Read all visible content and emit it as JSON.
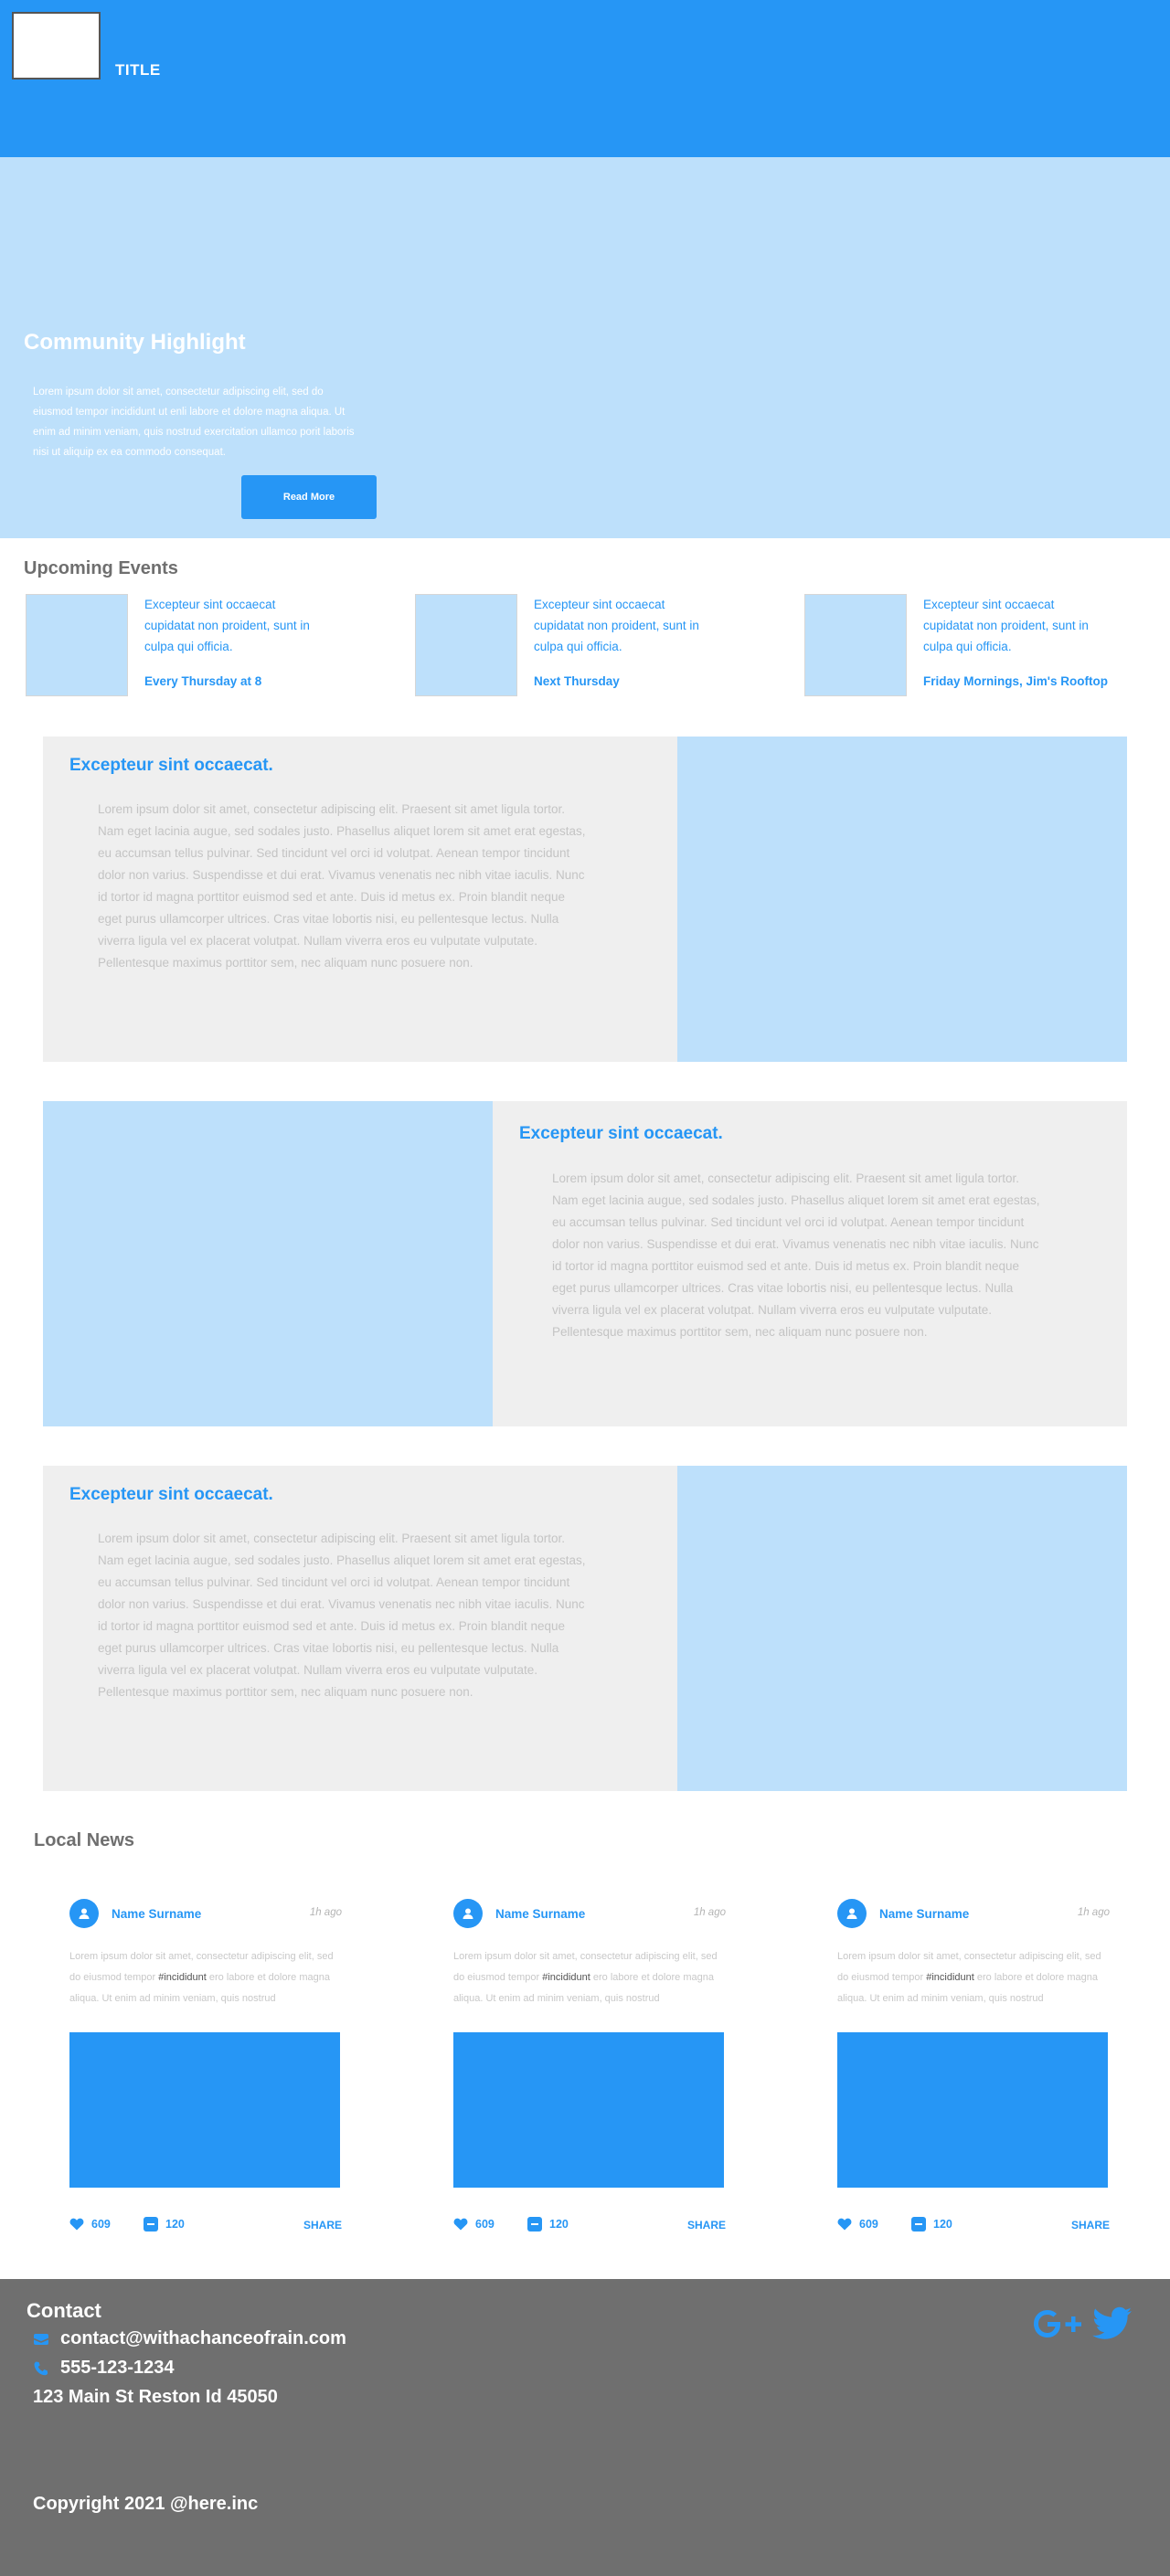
{
  "header": {
    "title": "TITLE"
  },
  "hero": {
    "title": "Community Highlight",
    "text": "Lorem ipsum dolor sit amet, consectetur adipiscing elit, sed do eiusmod tempor incididunt ut enli labore et dolore magna aliqua. Ut enim ad minim veniam, quis nostrud exercitation ullamco porit laboris nisi ut aliquip ex ea commodo consequat.",
    "button_label": "Read More"
  },
  "events": {
    "title": "Upcoming Events",
    "items": [
      {
        "description": "Excepteur sint occaecat cupidatat non proident, sunt in culpa qui officia.",
        "when": "Every Thursday at 8"
      },
      {
        "description": "Excepteur sint occaecat cupidatat non proident, sunt in culpa qui officia.",
        "when": "Next Thursday"
      },
      {
        "description": "Excepteur sint occaecat cupidatat non proident, sunt in culpa qui officia.",
        "when": "Friday Mornings, Jim's Rooftop"
      }
    ]
  },
  "features": [
    {
      "title": "Excepteur sint occaecat.",
      "text": "Lorem ipsum dolor sit amet, consectetur adipiscing elit. Praesent sit amet ligula tortor. Nam eget lacinia augue, sed sodales justo. Phasellus aliquet lorem sit amet erat egestas, eu accumsan tellus pulvinar. Sed tincidunt vel orci id volutpat. Aenean tempor tincidunt dolor non varius. Suspendisse et dui erat. Vivamus venenatis nec nibh vitae iaculis. Nunc id tortor id magna porttitor euismod sed et ante. Duis id metus ex. Proin blandit neque eget purus ullamcorper ultrices. Cras vitae lobortis nisi, eu pellentesque lectus. Nulla viverra ligula vel ex placerat volutpat. Nullam viverra eros eu vulputate vulputate. Pellentesque maximus porttitor sem, nec aliquam nunc posuere non."
    },
    {
      "title": "Excepteur sint occaecat.",
      "text": "Lorem ipsum dolor sit amet, consectetur adipiscing elit. Praesent sit amet ligula tortor. Nam eget lacinia augue, sed sodales justo. Phasellus aliquet lorem sit amet erat egestas, eu accumsan tellus pulvinar. Sed tincidunt vel orci id volutpat. Aenean tempor tincidunt dolor non varius. Suspendisse et dui erat. Vivamus venenatis nec nibh vitae iaculis. Nunc id tortor id magna porttitor euismod sed et ante. Duis id metus ex. Proin blandit neque eget purus ullamcorper ultrices. Cras vitae lobortis nisi, eu pellentesque lectus. Nulla viverra ligula vel ex placerat volutpat. Nullam viverra eros eu vulputate vulputate. Pellentesque maximus porttitor sem, nec aliquam nunc posuere non."
    },
    {
      "title": "Excepteur sint occaecat.",
      "text": "Lorem ipsum dolor sit amet, consectetur adipiscing elit. Praesent sit amet ligula tortor. Nam eget lacinia augue, sed sodales justo. Phasellus aliquet lorem sit amet erat egestas, eu accumsan tellus pulvinar. Sed tincidunt vel orci id volutpat. Aenean tempor tincidunt dolor non varius. Suspendisse et dui erat. Vivamus venenatis nec nibh vitae iaculis. Nunc id tortor id magna porttitor euismod sed et ante. Duis id metus ex. Proin blandit neque eget purus ullamcorper ultrices. Cras vitae lobortis nisi, eu pellentesque lectus. Nulla viverra ligula vel ex placerat volutpat. Nullam viverra eros eu vulputate vulputate. Pellentesque maximus porttitor sem, nec aliquam nunc posuere non."
    }
  ],
  "news": {
    "title": "Local News",
    "cards": [
      {
        "name": "Name Surname",
        "time": "1h ago",
        "text_before": "Lorem ipsum dolor sit amet, consectetur adipiscing elit, sed do eiusmod tempor ",
        "hashtag": "#incididunt",
        "text_after": " ero labore et dolore magna aliqua. Ut enim ad minim veniam, quis nostrud",
        "likes": "609",
        "comments": "120",
        "share_label": "SHARE"
      },
      {
        "name": "Name Surname",
        "time": "1h ago",
        "text_before": "Lorem ipsum dolor sit amet, consectetur adipiscing elit, sed do eiusmod tempor ",
        "hashtag": "#incididunt",
        "text_after": " ero labore et dolore magna aliqua. Ut enim ad minim veniam, quis nostrud",
        "likes": "609",
        "comments": "120",
        "share_label": "SHARE"
      },
      {
        "name": "Name Surname",
        "time": "1h ago",
        "text_before": "Lorem ipsum dolor sit amet, consectetur adipiscing elit, sed do eiusmod tempor ",
        "hashtag": "#incididunt",
        "text_after": " ero labore et dolore magna aliqua. Ut enim ad minim veniam, quis nostrud",
        "likes": "609",
        "comments": "120",
        "share_label": "SHARE"
      }
    ]
  },
  "footer": {
    "contact_title": "Contact",
    "email": "contact@withachanceofrain.com",
    "phone": "555-123-1234",
    "address": "123 Main St Reston Id 45050",
    "copyright": "Copyright 2021 @here.inc",
    "socials": [
      "google-plus-icon",
      "twitter-icon"
    ]
  },
  "colors": {
    "primary": "#2696f5",
    "light": "#bde0fb",
    "panel": "#efefef",
    "footer": "#6f6f6f",
    "heading_gray": "#6f6f6f"
  }
}
